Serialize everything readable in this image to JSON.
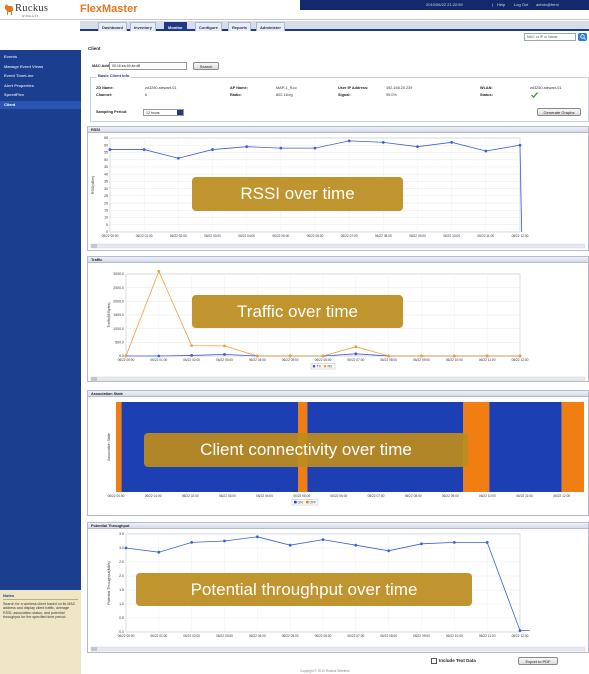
{
  "header": {
    "logo_word": "Ruckus",
    "logo_sub": "WIRELESS",
    "brand": "FlexMaster",
    "timestamp": "2010/06/22 21:22:59",
    "help": "Help",
    "logout": "Log Out",
    "user": "admin@ferni"
  },
  "nav": {
    "tabs": [
      "Dashboard",
      "Inventory",
      "Monitor",
      "Configure",
      "Reports",
      "Administer"
    ],
    "active_index": 2,
    "search_placeholder": "MAC or IP or Name"
  },
  "sidebar": {
    "items": [
      "Events",
      "Manage Event Views",
      "Event TimeLine",
      "Alert Properties",
      "SpeedFlex",
      "Client"
    ],
    "active_index": 5,
    "notes_title": "Notes",
    "notes_body": "Search for a wireless client based on its MAC address and display client traffic, average RSSI, association status, and potential throughput for the specified time period."
  },
  "client": {
    "section_title": "Client",
    "mac_label": "MAC Address",
    "mac_value": "00:16:ea:49:4e:d8",
    "search_button": "Search",
    "info_title": "Basic Client Info",
    "fields": {
      "zd_name_label": "ZD Name:",
      "zd_name": "zd3250-stewart-01",
      "channel_label": "Channel:",
      "channel": "6",
      "ap_name_label": "AP Name:",
      "ap_name": "MAP-1_ff-cc",
      "radio_label": "Radio:",
      "radio": "802.11b/g",
      "user_ip_label": "User IP Address:",
      "user_ip": "192.168.20.239",
      "signal_label": "Signal:",
      "signal": "99.0%",
      "wlan_label": "WLAN:",
      "wlan": "zd3250-stewart-01",
      "status_label": "Status:"
    },
    "sampling_label": "Sampling Period:",
    "sampling_value": "12 hours",
    "generate_button": "Generate Graphs"
  },
  "time_ticks": [
    "06/22 00:00",
    "06/22 01:00",
    "06/22 02:00",
    "06/22 03:00",
    "06/22 04:00",
    "06/22 05:00",
    "06/22 06:00",
    "06/22 07:00",
    "06/22 08:00",
    "06/22 09:00",
    "06/22 10:00",
    "06/22 11:00",
    "06/22 12:00"
  ],
  "chart_data": [
    {
      "type": "line",
      "panel_title": "RSSI",
      "overlay": "RSSI over time",
      "ylabel": "RSSI(dBm)",
      "ylim": [
        0,
        65
      ],
      "yticks": [
        0,
        5,
        10,
        15,
        20,
        25,
        30,
        35,
        40,
        45,
        50,
        55,
        60,
        65
      ],
      "series": [
        {
          "color": "#3b5fd6",
          "x": [
            0,
            1,
            2,
            3,
            4,
            5,
            6,
            7,
            8,
            9,
            10,
            11,
            12,
            12.05
          ],
          "values": [
            57,
            57,
            51,
            57,
            59,
            58,
            58,
            63,
            62,
            59,
            62,
            56,
            60,
            0
          ]
        }
      ]
    },
    {
      "type": "line",
      "panel_title": "Traffic",
      "overlay": "Traffic over time",
      "ylabel": "Traffic(M Bytes)",
      "ylim": [
        0,
        3000
      ],
      "yticks": [
        0,
        500,
        1000,
        1500,
        2000,
        2500,
        3000
      ],
      "yticklabels": [
        "0.0",
        "500.0",
        "1000.0",
        "1500.0",
        "2000.0",
        "2500.0",
        "3000.0"
      ],
      "legend": [
        "TX",
        "RX"
      ],
      "series": [
        {
          "name": "TX",
          "color": "#3b5fd6",
          "x": [
            0,
            1,
            2,
            3,
            4,
            5,
            6,
            7,
            8,
            9,
            10,
            11,
            12
          ],
          "values": [
            0,
            0,
            20,
            60,
            0,
            0,
            0,
            80,
            0,
            0,
            0,
            0,
            0
          ]
        },
        {
          "name": "RX",
          "color": "#f0a030",
          "x": [
            0,
            1,
            2,
            3,
            4,
            5,
            6,
            7,
            8,
            9,
            10,
            11,
            12
          ],
          "values": [
            0,
            3100,
            380,
            370,
            0,
            0,
            0,
            340,
            0,
            0,
            0,
            0,
            0
          ]
        }
      ]
    },
    {
      "type": "area",
      "panel_title": "Association State",
      "overlay": "Client connectivity over time",
      "ylabel": "Association State",
      "legend": [
        "ON",
        "OFF"
      ],
      "colors": {
        "ON": "#1c3fb4",
        "OFF": "#f07e12"
      },
      "segments": [
        {
          "state": "OFF",
          "start": 0,
          "end": 0.15
        },
        {
          "state": "ON",
          "start": 0.15,
          "end": 4.9
        },
        {
          "state": "OFF",
          "start": 4.9,
          "end": 5.15
        },
        {
          "state": "ON",
          "start": 5.15,
          "end": 9.35
        },
        {
          "state": "OFF",
          "start": 9.35,
          "end": 10.05
        },
        {
          "state": "ON",
          "start": 10.05,
          "end": 12.0
        },
        {
          "state": "OFF",
          "start": 12.0,
          "end": 12.6
        }
      ]
    },
    {
      "type": "line",
      "panel_title": "Potential Throughput",
      "overlay": "Potential throughput over time",
      "ylabel": "Potential Throughput(Mb/s)",
      "ylim": [
        0,
        3.5
      ],
      "yticks": [
        0,
        0.5,
        1,
        1.5,
        2,
        2.5,
        3,
        3.5
      ],
      "yticklabels": [
        "0.0",
        "0.5",
        "1.0",
        "1.5",
        "2.0",
        "2.5",
        "3.0",
        "3.5"
      ],
      "series": [
        {
          "color": "#3b5fd6",
          "x": [
            0,
            1,
            2,
            3,
            4,
            5,
            6,
            7,
            8,
            9,
            10,
            11,
            12,
            12.3
          ],
          "values": [
            3.0,
            2.85,
            3.2,
            3.25,
            3.4,
            3.1,
            3.3,
            3.1,
            2.9,
            3.15,
            3.2,
            3.2,
            0.05,
            0.05
          ]
        }
      ]
    }
  ],
  "footer": {
    "include_text": "Include Text Data",
    "export_button": "Export to PDF",
    "copyright": "Copyright © 2010 Ruckus Wireless"
  }
}
